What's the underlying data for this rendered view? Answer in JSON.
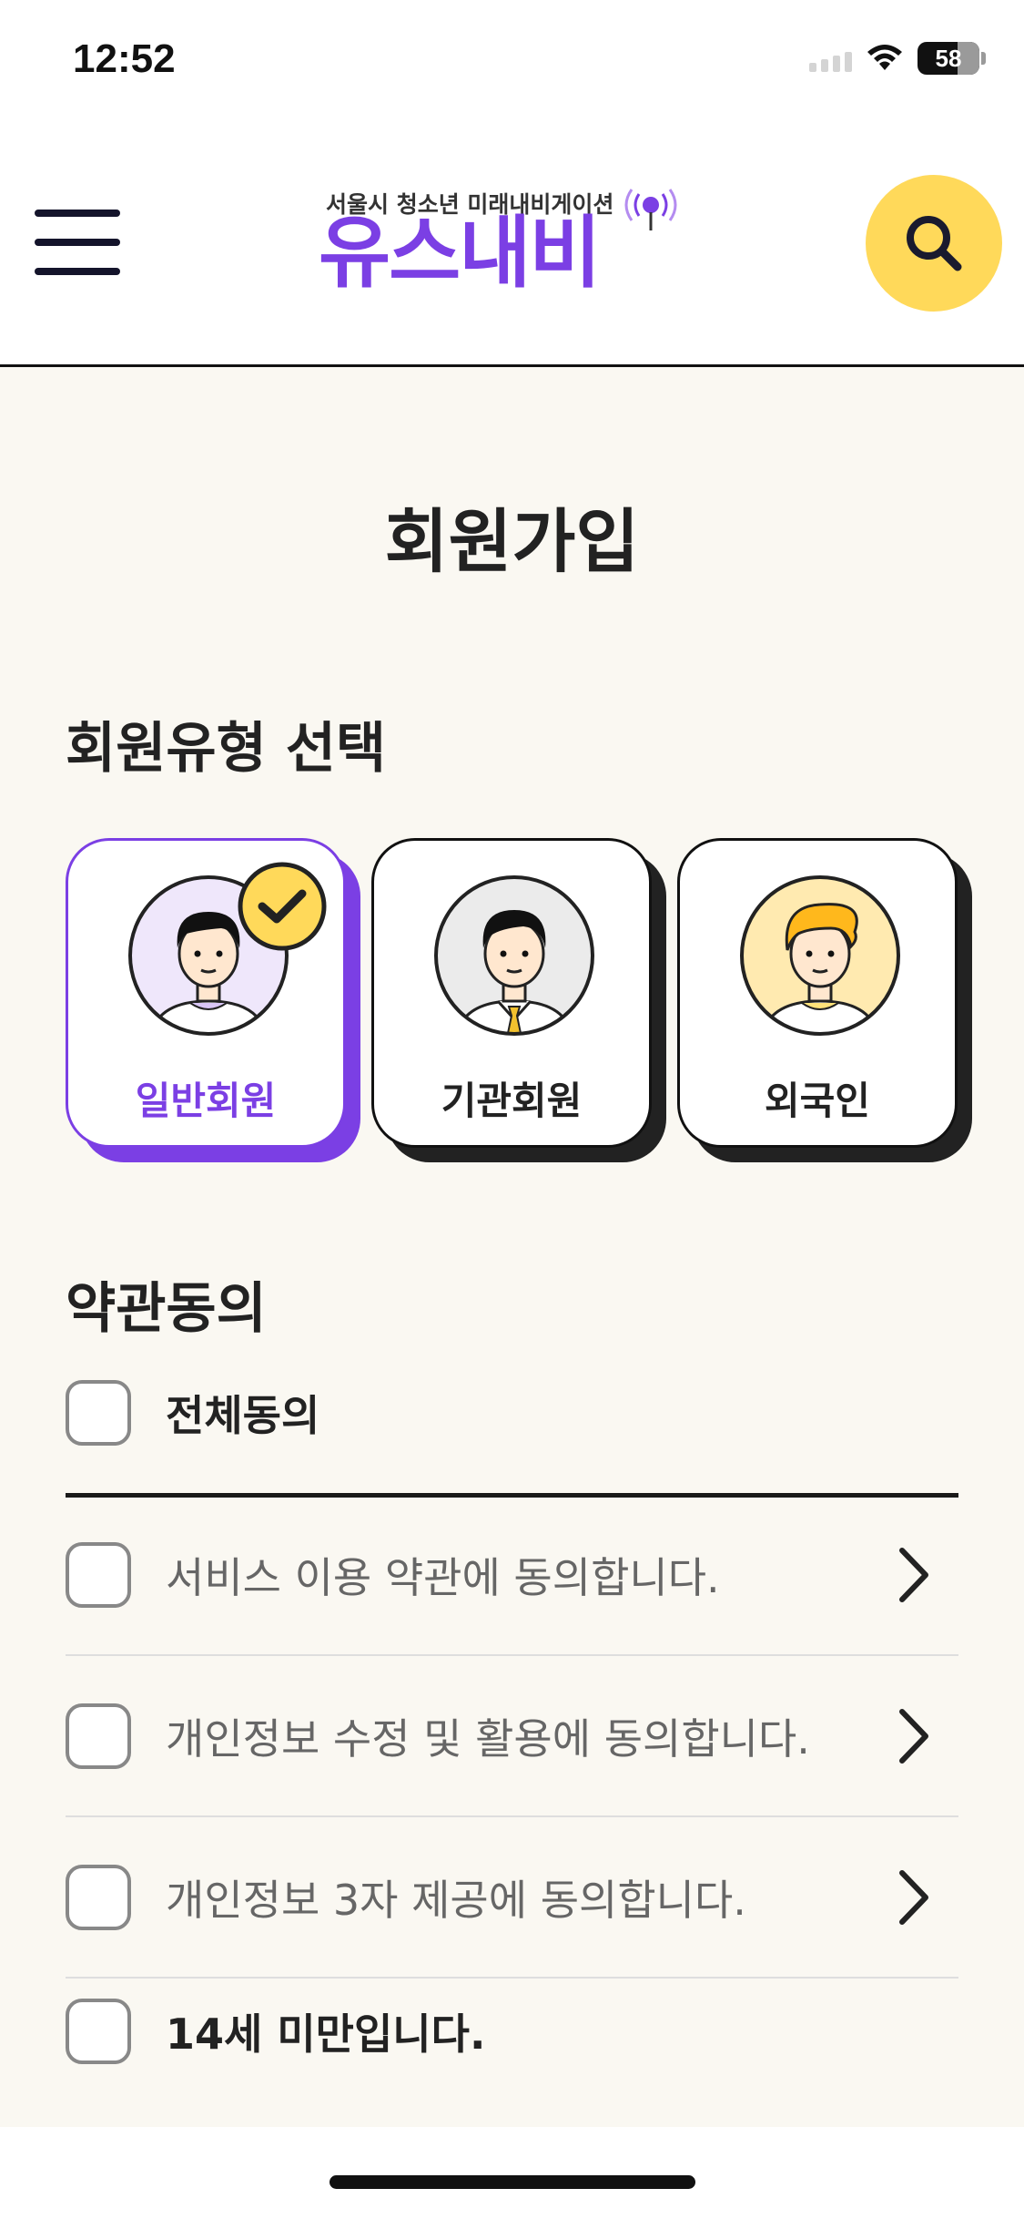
{
  "status_bar": {
    "time": "12:52",
    "battery": "58"
  },
  "header": {
    "logo_subtitle": "서울시 청소년 미래내비게이션",
    "logo_title": "유스내비"
  },
  "page": {
    "title": "회원가입"
  },
  "member_type": {
    "section_title": "회원유형 선택",
    "options": [
      {
        "label": "일반회원",
        "selected": true
      },
      {
        "label": "기관회원",
        "selected": false
      },
      {
        "label": "외국인",
        "selected": false
      }
    ]
  },
  "terms": {
    "section_title": "약관동의",
    "agree_all": "전체동의",
    "items": [
      {
        "label": "서비스 이용 약관에 동의합니다.",
        "checked": false
      },
      {
        "label": "개인정보 수정 및 활용에 동의합니다.",
        "checked": false
      },
      {
        "label": "개인정보 3자 제공에 동의합니다.",
        "checked": false
      },
      {
        "label": "14세 미만입니다.",
        "checked": false
      }
    ]
  },
  "colors": {
    "accent": "#7b3fe4",
    "search_bg": "#ffd95a",
    "background": "#faf8f2"
  }
}
